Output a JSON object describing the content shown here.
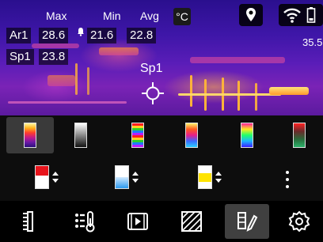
{
  "measurements": {
    "headers": {
      "max": "Max",
      "min": "Min",
      "avg": "Avg"
    },
    "unit": "°C",
    "area": {
      "label": "Ar1",
      "max": "28.6",
      "min": "21.6",
      "avg": "22.8"
    },
    "spot": {
      "label": "Sp1",
      "value": "23.8"
    },
    "spot_marker_label": "Sp1",
    "scale_max": "35.5"
  },
  "status_icons": [
    "location-pin-icon",
    "wifi-icon",
    "battery-icon"
  ],
  "palettes": {
    "items": [
      "iron",
      "white-hot",
      "rainbow-high-contrast",
      "lava",
      "rainbow",
      "medical"
    ],
    "selected": "iron"
  },
  "isotherm_modes": [
    "above",
    "below",
    "interval"
  ],
  "toolbar": {
    "items": [
      "scale-tool",
      "parameters",
      "video-playback",
      "measurement-area",
      "palette",
      "settings"
    ],
    "active": "palette"
  },
  "colors": {
    "accent_yellow": "#ffe400",
    "isotherm_red": "#e8141c",
    "isotherm_blue": "#2d9bf0",
    "selected_bg": "#3a3a3a"
  }
}
